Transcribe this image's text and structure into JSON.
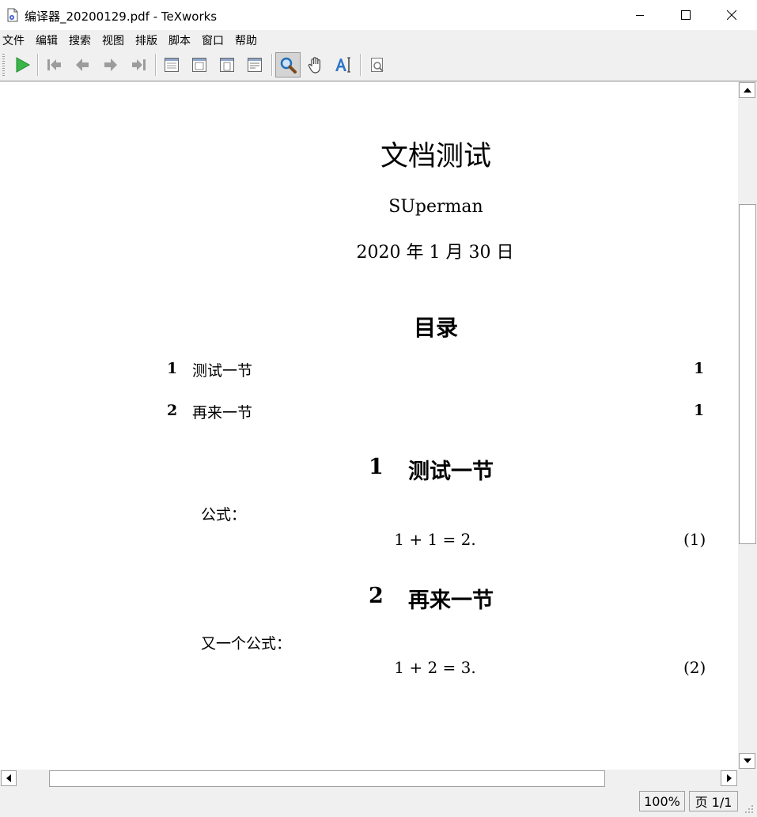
{
  "window": {
    "title": "编译器_20200129.pdf - TeXworks",
    "minimize_icon": "minimize-icon",
    "maximize_icon": "maximize-icon",
    "close_icon": "close-icon"
  },
  "menu": {
    "items": [
      "文件",
      "编辑",
      "搜索",
      "视图",
      "排版",
      "脚本",
      "窗口",
      "帮助"
    ]
  },
  "toolbar": {
    "icons": [
      "typeset-play-icon",
      "first-page-icon",
      "previous-page-icon",
      "next-page-icon",
      "last-page-icon",
      "actual-size-icon",
      "fit-width-icon",
      "fit-window-icon",
      "fit-content-icon",
      "magnify-icon",
      "scroll-hand-icon",
      "select-text-icon",
      "find-in-pdf-icon"
    ],
    "colors": {
      "play": "#39b54a",
      "magnify": "#1e6fb8",
      "disabled": "#9c9c9c"
    }
  },
  "document": {
    "title": "文档测试",
    "author": "SUperman",
    "date": "2020 年 1 月 30 日",
    "toc_heading": "目录",
    "toc": [
      {
        "num": "1",
        "label": "测试一节",
        "page": "1"
      },
      {
        "num": "2",
        "label": "再来一节",
        "page": "1"
      }
    ],
    "sections": [
      {
        "num": "1",
        "title": "测试一节",
        "lead": "公式：",
        "equation": "1 + 1 = 2.",
        "eq_num": "(1)"
      },
      {
        "num": "2",
        "title": "再来一节",
        "lead": "又一个公式：",
        "equation": "1 + 2 = 3.",
        "eq_num": "(2)"
      }
    ]
  },
  "status": {
    "zoom": "100%",
    "page": "页 1/1"
  },
  "scrollbars": {
    "up_arrow": "scroll-up-arrow-icon",
    "down_arrow": "scroll-down-arrow-icon",
    "left_arrow": "scroll-left-arrow-icon",
    "right_arrow": "scroll-right-arrow-icon"
  }
}
